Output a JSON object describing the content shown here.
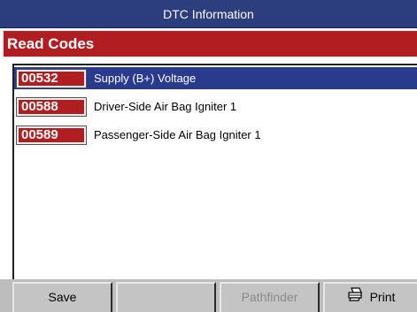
{
  "window": {
    "title": "DTC Information"
  },
  "header": {
    "label": "Read Codes"
  },
  "codes": [
    {
      "code": "00532",
      "description": "Supply (B+) Voltage",
      "selected": true
    },
    {
      "code": "00588",
      "description": "Driver-Side Air Bag Igniter 1",
      "selected": false
    },
    {
      "code": "00589",
      "description": "Passenger-Side Air Bag Igniter 1",
      "selected": false
    }
  ],
  "toolbar": {
    "save_label": "Save",
    "blank_label": "",
    "pathfinder_label": "Pathfinder",
    "print_label": "Print",
    "print_icon": "printer-icon"
  },
  "colors": {
    "title_bar": "#2c3e7e",
    "header_bar": "#b01e22",
    "selection": "#2a3a8c",
    "code_badge": "#b01e22",
    "toolbar": "#c4c4c4"
  }
}
